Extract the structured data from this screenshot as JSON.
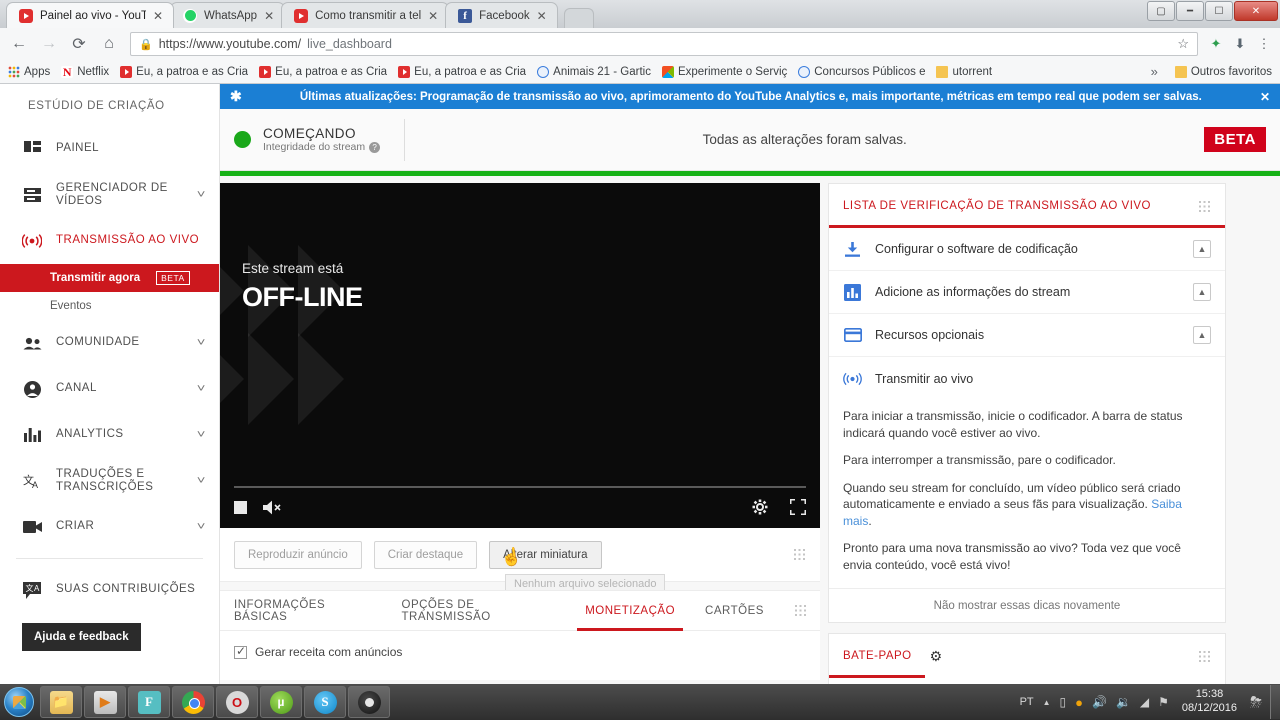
{
  "browser": {
    "tabs": [
      {
        "title": "Painel ao vivo - YouTube",
        "icon": "youtube-icon",
        "active": true
      },
      {
        "title": "WhatsApp",
        "icon": "whatsapp-icon",
        "active": false
      },
      {
        "title": "Como transmitir a tela d",
        "icon": "youtube-icon",
        "active": false
      },
      {
        "title": "Facebook",
        "icon": "facebook-icon",
        "active": false
      }
    ],
    "window_controls": {
      "restore": "☐",
      "minimize": "–",
      "maximize": "❐",
      "close": "✕"
    },
    "nav": {
      "back": "←",
      "forward": "→",
      "reload": "⟳",
      "home": "⌂"
    },
    "omnibox": {
      "lock": "🔒",
      "url_secure": "https://www.youtube.com/",
      "url_path": "live_dashboard",
      "star": "☆"
    },
    "extensions": [
      {
        "name": "extension-icon",
        "glyph": "✦",
        "color": "#2e9e4f"
      },
      {
        "name": "download-icon",
        "glyph": "⬇",
        "color": "#5a6670"
      },
      {
        "name": "chrome-menu-icon",
        "glyph": "⋮",
        "color": "#5f6368"
      }
    ],
    "bookmarks": [
      {
        "label": "Apps",
        "icon": "apps-grid-icon"
      },
      {
        "label": "Netflix",
        "icon": "netflix-icon"
      },
      {
        "label": "Eu, a patroa e as Crian",
        "icon": "youtube-icon"
      },
      {
        "label": "Eu, a patroa e as Crian",
        "icon": "youtube-icon"
      },
      {
        "label": "Eu, a patroa e as Crian",
        "icon": "youtube-icon"
      },
      {
        "label": "Animais 21 - Gartic",
        "icon": "circle-icon"
      },
      {
        "label": "Experimente o Serviç",
        "icon": "microsoft-icon"
      },
      {
        "label": "Concursos Públicos e",
        "icon": "circle-icon"
      },
      {
        "label": "utorrent",
        "icon": "folder-icon"
      }
    ],
    "bookmarks_overflow": "»",
    "other_bookmarks": {
      "label": "Outros favoritos",
      "icon": "folder-icon"
    }
  },
  "sidebar": {
    "title": "ESTÚDIO DE CRIAÇÃO",
    "items": [
      {
        "label": "PAINEL",
        "icon": "dashboard-icon",
        "chevron": false
      },
      {
        "label": "GERENCIADOR DE VÍDEOS",
        "icon": "video-manager-icon",
        "chevron": true
      },
      {
        "label": "TRANSMISSÃO AO VIVO",
        "icon": "live-broadcast-icon",
        "chevron": false,
        "active": true
      },
      {
        "label": "COMUNIDADE",
        "icon": "community-icon",
        "chevron": true
      },
      {
        "label": "CANAL",
        "icon": "channel-icon",
        "chevron": true
      },
      {
        "label": "ANALYTICS",
        "icon": "analytics-icon",
        "chevron": true
      },
      {
        "label": "TRADUÇÕES E TRANSCRIÇÕES",
        "icon": "translate-icon",
        "chevron": true
      },
      {
        "label": "CRIAR",
        "icon": "create-icon",
        "chevron": true
      }
    ],
    "sub_items": [
      {
        "label": "Transmitir agora",
        "badge": "BETA",
        "active": true
      },
      {
        "label": "Eventos",
        "badge": "",
        "active": false
      }
    ],
    "contributions": {
      "label": "SUAS CONTRIBUIÇÕES",
      "icon": "contributions-icon"
    },
    "help_button": "Ajuda e feedback"
  },
  "notice": {
    "star_icon": "✱",
    "text": "Últimas atualizações: Programação de transmissão ao vivo, aprimoramento do YouTube Analytics e, mais importante, métricas em tempo real que podem ser salvas.",
    "close": "✕",
    "bg_color": "#1b7fd4"
  },
  "status": {
    "state": "COMEÇANDO",
    "sub_label": "Integridade do stream",
    "help_glyph": "?",
    "saved_message": "Todas as alterações foram salvas.",
    "beta_badge": "BETA",
    "dot_color": "#1aa81a",
    "bar_color": "#17b217"
  },
  "player": {
    "offline_sub": "Este stream está",
    "offline_title": "OFF-LINE",
    "controls": {
      "stop": "stop-icon",
      "mute": "🔇",
      "settings": "⚙",
      "fullscreen": "⛶"
    }
  },
  "actions": {
    "buttons": [
      {
        "label": "Reproduzir anúncio",
        "enabled": false
      },
      {
        "label": "Criar destaque",
        "enabled": false
      },
      {
        "label": "Alterar miniatura",
        "enabled": true
      }
    ],
    "tooltip": "Nenhum arquivo selecionado",
    "cursor": "☝"
  },
  "content_tabs": {
    "items": [
      {
        "label": "INFORMAÇÕES BÁSICAS",
        "active": false
      },
      {
        "label": "OPÇÕES DE TRANSMISSÃO",
        "active": false
      },
      {
        "label": "MONETIZAÇÃO",
        "active": true
      },
      {
        "label": "CARTÕES",
        "active": false
      }
    ],
    "checkbox_label": "Gerar receita com anúncios",
    "checkbox_checked": true
  },
  "checklist": {
    "title": "LISTA DE VERIFICAÇÃO DE TRANSMISSÃO AO VIVO",
    "items": [
      {
        "label": "Configurar o software de codificação",
        "icon": "download-icon",
        "collapse": "⌃⌃"
      },
      {
        "label": "Adicione as informações do stream",
        "icon": "bar-chart-icon",
        "collapse": "⌃⌃"
      },
      {
        "label": "Recursos opcionais",
        "icon": "card-icon",
        "collapse": "⌃⌃"
      },
      {
        "label": "Transmitir ao vivo",
        "icon": "live-broadcast-icon",
        "collapse": ""
      }
    ],
    "tips": [
      "Para iniciar a transmissão, inicie o codificador. A barra de status indicará quando você estiver ao vivo.",
      "Para interromper a transmissão, pare o codificador.",
      "Quando seu stream for concluído, um vídeo público será criado automaticamente e enviado a seus fãs para visualização.",
      "Pronto para uma nova transmissão ao vivo? Toda vez que você envia conteúdo, você está vivo!"
    ],
    "learn_more": "Saiba mais",
    "dismiss": "Não mostrar essas dicas novamente"
  },
  "chat": {
    "title": "BATE-PAPO",
    "settings_icon": "⚙"
  },
  "taskbar": {
    "start": "start-orb",
    "apps": [
      {
        "name": "file-explorer",
        "glyph": "📁"
      },
      {
        "name": "windows-media-player",
        "glyph": "▶"
      },
      {
        "name": "format-factory",
        "glyph": "F"
      },
      {
        "name": "google-chrome",
        "glyph": ""
      },
      {
        "name": "opera",
        "glyph": "O"
      },
      {
        "name": "utorrent",
        "glyph": "µ"
      },
      {
        "name": "skype",
        "glyph": "S"
      },
      {
        "name": "obs-studio",
        "glyph": ""
      }
    ],
    "tray": {
      "language": "PT",
      "expand": "▲",
      "icons": [
        {
          "name": "battery-icon",
          "glyph": "▯"
        },
        {
          "name": "antivirus-icon",
          "glyph": "●"
        },
        {
          "name": "sound-icon",
          "glyph": "🔊"
        },
        {
          "name": "volume-icon",
          "glyph": "🔉"
        },
        {
          "name": "network-icon",
          "glyph": "◢"
        },
        {
          "name": "action-center-icon",
          "glyph": "⚑"
        }
      ],
      "time": "15:38",
      "date": "08/12/2016",
      "weather_icon": "⛈"
    }
  }
}
